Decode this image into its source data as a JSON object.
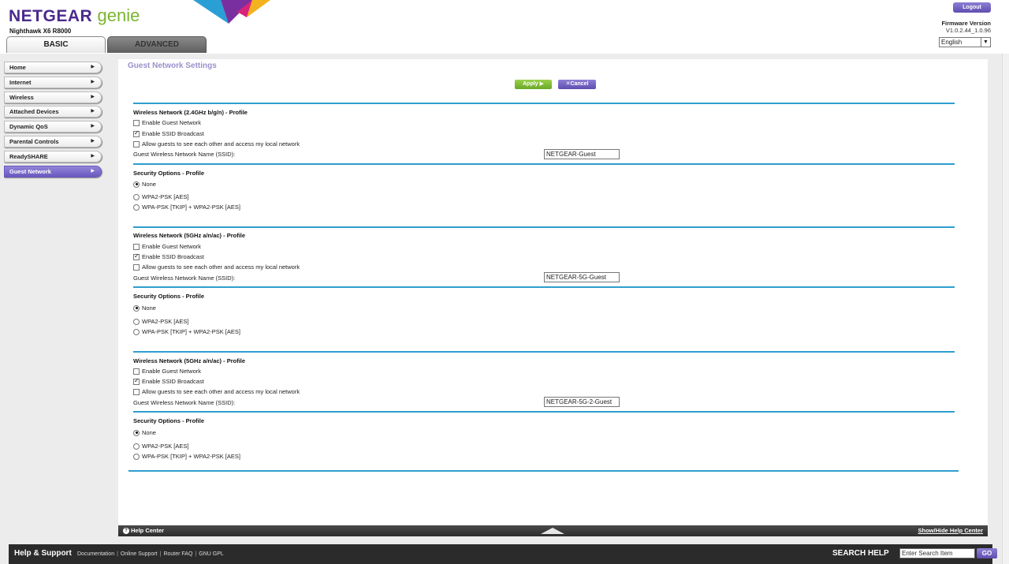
{
  "header": {
    "logo_brand": "NETGEAR",
    "logo_product": "genie",
    "model": "Nighthawk X6 R8000",
    "tabs": [
      {
        "label": "BASIC"
      },
      {
        "label": "ADVANCED"
      }
    ],
    "logout_label": "Logout",
    "firmware_label": "Firmware Version",
    "firmware_value": "V1.0.2.44_1.0.96",
    "language": "English"
  },
  "sidebar": {
    "items": [
      {
        "label": "Home"
      },
      {
        "label": "Internet"
      },
      {
        "label": "Wireless"
      },
      {
        "label": "Attached Devices"
      },
      {
        "label": "Dynamic QoS"
      },
      {
        "label": "Parental Controls"
      },
      {
        "label": "ReadySHARE"
      },
      {
        "label": "Guest Network"
      }
    ]
  },
  "main": {
    "title": "Guest Network Settings",
    "apply_label": "Apply ▶",
    "cancel_label": "Cancel",
    "profiles": [
      {
        "title": "Wireless Network (2.4GHz b/g/n) - Profile",
        "enable_guest": "Enable Guest Network",
        "enable_ssid": "Enable SSID Broadcast",
        "allow_guests": "Allow guests to see each other and access my local network",
        "ssid_label": "Guest Wireless Network Name (SSID):",
        "ssid_value": "NETGEAR-Guest",
        "security_title": "Security Options - Profile",
        "opt_none": "None",
        "opt_wpa2": "WPA2-PSK [AES]",
        "opt_mixed": "WPA-PSK [TKIP] + WPA2-PSK [AES]"
      },
      {
        "title": "Wireless Network (5GHz a/n/ac) - Profile",
        "enable_guest": "Enable Guest Network",
        "enable_ssid": "Enable SSID Broadcast",
        "allow_guests": "Allow guests to see each other and access my local network",
        "ssid_label": "Guest Wireless Network Name (SSID):",
        "ssid_value": "NETGEAR-5G-Guest",
        "security_title": "Security Options - Profile",
        "opt_none": "None",
        "opt_wpa2": "WPA2-PSK [AES]",
        "opt_mixed": "WPA-PSK [TKIP] + WPA2-PSK [AES]"
      },
      {
        "title": "Wireless Network (5GHz a/n/ac) - Profile",
        "enable_guest": "Enable Guest Network",
        "enable_ssid": "Enable SSID Broadcast",
        "allow_guests": "Allow guests to see each other and access my local network",
        "ssid_label": "Guest Wireless Network Name (SSID):",
        "ssid_value": "NETGEAR-5G-2-Guest",
        "security_title": "Security Options - Profile",
        "opt_none": "None",
        "opt_wpa2": "WPA2-PSK [AES]",
        "opt_mixed": "WPA-PSK [TKIP] + WPA2-PSK [AES]"
      }
    ]
  },
  "helpbar": {
    "help_center": "Help Center",
    "show_hide": "Show/Hide Help Center"
  },
  "footer": {
    "help_support": "Help & Support",
    "links": [
      "Documentation",
      "Online Support",
      "Router FAQ",
      "GNU GPL"
    ],
    "search_help": "SEARCH HELP",
    "search_placeholder": "Enter Search Item",
    "go_label": "GO"
  },
  "colors": {
    "accent_purple": "#6a58bf",
    "accent_green": "#7ab52f",
    "divider_blue": "#2f9ecf"
  }
}
